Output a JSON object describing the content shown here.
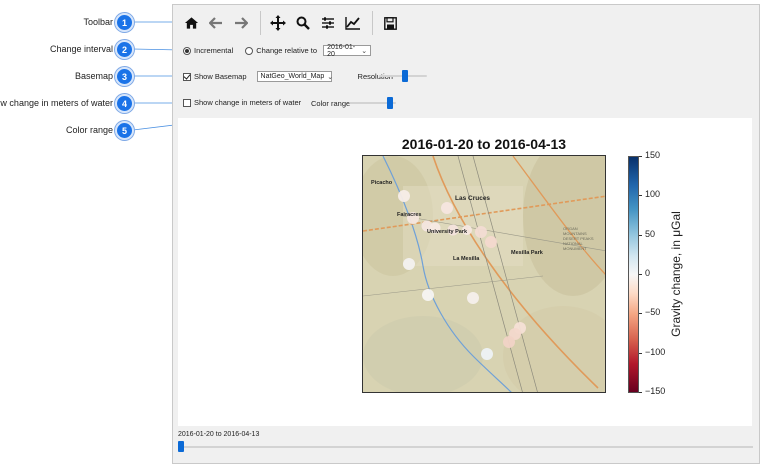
{
  "callouts": [
    {
      "number": "1",
      "label": "Toolbar"
    },
    {
      "number": "2",
      "label": "Change interval"
    },
    {
      "number": "3",
      "label": "Basemap"
    },
    {
      "number": "4",
      "label": "Show change in meters of water"
    },
    {
      "number": "5",
      "label": "Color range"
    }
  ],
  "toolbar": {
    "icons": [
      "home-icon",
      "back-arrow-icon",
      "forward-arrow-icon",
      "pan-icon",
      "zoom-icon",
      "configure-subplots-icon",
      "edit-axis-icon",
      "save-icon"
    ]
  },
  "change_interval": {
    "incremental_label": "Incremental",
    "relative_label": "Change relative to",
    "selected_mode": "Incremental",
    "date_value": "2016-01-20"
  },
  "basemap": {
    "show_label": "Show Basemap",
    "show_checked": true,
    "map_value": "NatGeo_World_Map",
    "resolution_label": "Resolution",
    "resolution_fraction": 0.55
  },
  "water": {
    "label": "Show change in meters of water",
    "checked": false,
    "color_range_label": "Color range",
    "color_range_fraction": 0.93
  },
  "map": {
    "title": "2016-01-20 to 2016-04-13",
    "place_labels": [
      "Picacho",
      "Las Cruces",
      "Fairacres",
      "University Park",
      "La Mesilla",
      "Mesilla Park",
      "ORGAN MOUNTAINS DESERT PEAKS NATIONAL MONUMENT"
    ]
  },
  "colorbar": {
    "label": "Gravity change, in μGal",
    "ticks": [
      "150",
      "100",
      "50",
      "0",
      "−50",
      "−100",
      "−150"
    ],
    "colors": {
      "high": "#08306b",
      "mid": "#f7f7f7",
      "low": "#67001f"
    }
  },
  "time_slider": {
    "label": "2016-01-20 to 2016-04-13",
    "position_fraction": 0.0
  }
}
